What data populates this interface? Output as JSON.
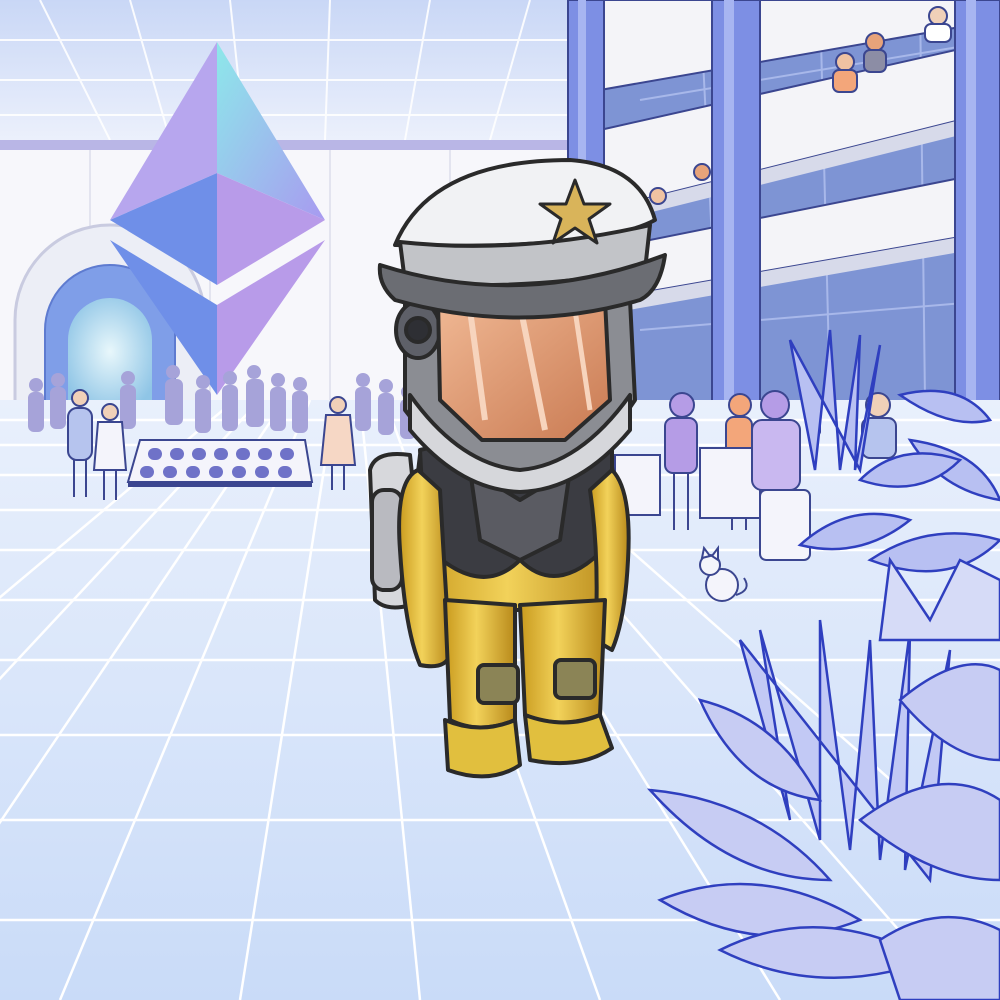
{
  "scene": {
    "colors": {
      "sky": "#f6f7fd",
      "floor": "#d9e6fb",
      "grid": "#ffffff",
      "accent_blue": "#6f8fe8",
      "accent_purple": "#b59ce6",
      "crowd": "#a6a3d9",
      "suit_yellow": "#e4c03a",
      "suit_shadow": "#b98f1d",
      "helmet_grey": "#8b8d93",
      "visor": "#e7a57a",
      "cap_white": "#f1f2f4",
      "star_gold": "#d9b45a",
      "plant_outline": "#2f3fbf",
      "plant_fill": "#b8c0f2"
    },
    "icons": [
      "ethereum-logo-icon",
      "star-icon",
      "cat-icon",
      "plant-icon"
    ]
  }
}
